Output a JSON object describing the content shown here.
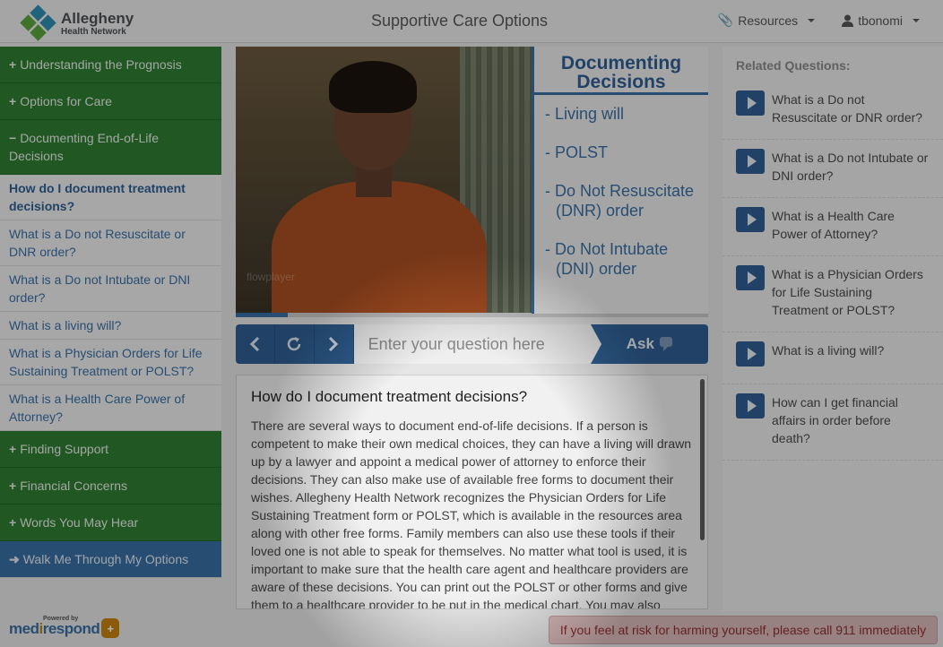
{
  "header": {
    "logo_line1": "Allegheny",
    "logo_line2": "Health Network",
    "title": "Supportive Care Options",
    "resources_label": "Resources",
    "user_label": "tbonomi"
  },
  "sidebar": {
    "items": [
      {
        "type": "green",
        "symbol": "+",
        "label": "Understanding the Prognosis"
      },
      {
        "type": "green",
        "symbol": "+",
        "label": "Options for Care"
      },
      {
        "type": "green",
        "symbol": "−",
        "label": "Documenting End-of-Life Decisions"
      },
      {
        "type": "sub",
        "active": true,
        "label": "How do I document treatment decisions?"
      },
      {
        "type": "sub",
        "label": "What is a Do not Resuscitate or DNR order?"
      },
      {
        "type": "sub",
        "label": "What is a Do not Intubate or DNI order?"
      },
      {
        "type": "sub",
        "label": "What is a living will?"
      },
      {
        "type": "sub",
        "label": "What is a Physician Orders for Life Sustaining Treatment or POLST?"
      },
      {
        "type": "sub",
        "label": "What is a Health Care Power of Attorney?"
      },
      {
        "type": "green",
        "symbol": "+",
        "label": "Finding Support"
      },
      {
        "type": "green",
        "symbol": "+",
        "label": "Financial Concerns"
      },
      {
        "type": "green",
        "symbol": "+",
        "label": "Words You May Hear"
      },
      {
        "type": "blue",
        "symbol": "➜",
        "label": "Walk Me Through My Options"
      }
    ]
  },
  "video": {
    "watermark": "flowplayer",
    "progress": 0.11
  },
  "slide": {
    "title": "Documenting Decisions",
    "items": [
      "- Living will",
      "- POLST",
      "- Do Not Resuscitate (DNR) order",
      "- Do Not Intubate (DNI) order"
    ]
  },
  "askbar": {
    "placeholder": "Enter your question here",
    "ask_label": "Ask"
  },
  "answer": {
    "heading": "How do I document treatment decisions?",
    "body": "There are several ways to document end-of-life decisions. If a person is competent to make their own medical choices, they can have a living will drawn up by a lawyer and appoint a medical power of attorney to enforce their decisions. They can also make use of available free forms to document their wishes. Allegheny Health Network recognizes the Physician Orders for Life Sustaining Treatment form or POLST, which is available in the resources area along with other free forms. Family members can also use these tools if their loved one is not able to speak for themselves. No matter what tool is used, it is important to make sure that the health care agent and healthcare providers are aware of these decisions. You can print out the POLST or other forms and give them to a healthcare provider to be put in the medical chart. You may also"
  },
  "related": {
    "heading": "Related Questions:",
    "questions": [
      "What is a Do not Resuscitate or DNR order?",
      "What is a Do not Intubate or DNI order?",
      "What is a Health Care Power of Attorney?",
      "What is a Physician Orders for Life Sustaining Treatment or POLST?",
      "What is a living will?",
      "How can I get financial affairs in order before death?"
    ]
  },
  "footer": {
    "powered_by": "Powered by",
    "brand_part1": "med",
    "brand_part2": "i",
    "brand_part3": "respond",
    "alert": "If you feel at risk for harming yourself, please call 911 immediately"
  },
  "colors": {
    "green": "#2e7d32",
    "blue": "#2f5f92",
    "link": "#3a6ea5",
    "alert_bg": "#d9b9b9",
    "alert_text": "#8f2f2f"
  }
}
